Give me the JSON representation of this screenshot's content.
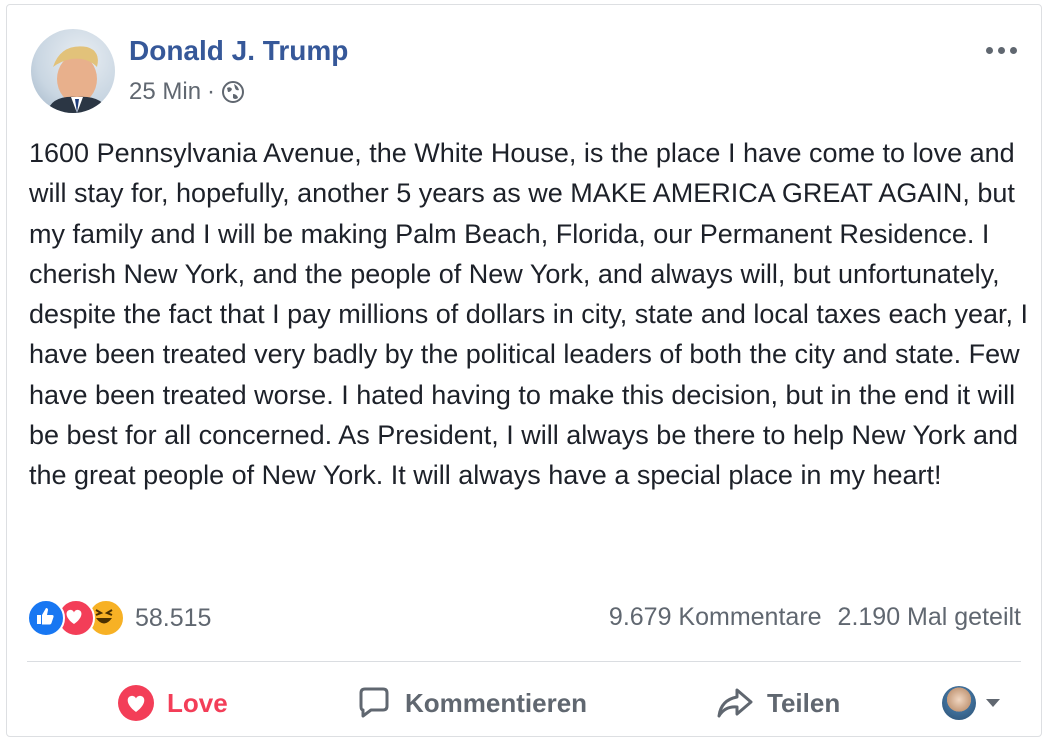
{
  "post": {
    "author": "Donald J. Trump",
    "time": "25 Min",
    "separator": "·",
    "privacy_icon": "globe-icon",
    "more_icon": "more-options-icon",
    "text": "1600 Pennsylvania Avenue, the White House, is the place I have come to love and will stay for, hopefully, another 5 years as we MAKE AMERICA GREAT AGAIN, but my family and I will be making Palm Beach, Florida, our Permanent Residence. I cherish New York, and the people of New York, and always will, but unfortunately, despite the fact that I pay millions of dollars in city, state and local taxes each year, I have been treated very badly by the political leaders of both the city and state. Few have been treated worse. I hated having to make this decision, but in the end it will be best for all concerned. As President, I will always be there to help New York and the great people of New York. It will always have a special place in my heart!"
  },
  "reactions": {
    "types": [
      "like",
      "love",
      "haha"
    ],
    "count": "58.515"
  },
  "stats": {
    "comments": "9.679 Kommentare",
    "shares": "2.190 Mal geteilt"
  },
  "actions": {
    "love_label": "Love",
    "comment_label": "Kommentieren",
    "share_label": "Teilen"
  },
  "colors": {
    "author": "#365899",
    "love": "#f33e58",
    "like": "#1877f2",
    "haha": "#f7b125",
    "secondary_text": "#606770"
  }
}
